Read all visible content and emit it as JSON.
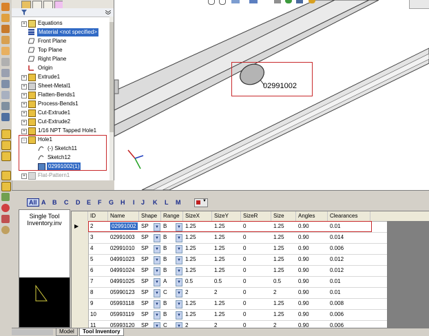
{
  "feature_tree": {
    "items": [
      {
        "label": "Equations",
        "expander": "+"
      },
      {
        "label": "Material <not specified>",
        "selected": true
      },
      {
        "label": "Front Plane"
      },
      {
        "label": "Top Plane"
      },
      {
        "label": "Right Plane"
      },
      {
        "label": "Origin"
      },
      {
        "label": "Extrude1",
        "expander": "+"
      },
      {
        "label": "Sheet-Metal1",
        "expander": "+"
      },
      {
        "label": "Flatten-Bends1",
        "expander": "+"
      },
      {
        "label": "Process-Bends1",
        "expander": "+"
      },
      {
        "label": "Cut-Extrude1",
        "expander": "+"
      },
      {
        "label": "Cut-Extrude2",
        "expander": "+"
      },
      {
        "label": "1/16 NPT Tapped Hole1",
        "expander": "+"
      },
      {
        "label": "Hole1",
        "expander": "−"
      },
      {
        "label": "(-) Sketch11"
      },
      {
        "label": "Sketch12"
      },
      {
        "label": "02991002(1)",
        "selected": true
      },
      {
        "label": "Flat-Pattern1",
        "expander": "+"
      }
    ]
  },
  "viewport": {
    "callout_label": "02991002"
  },
  "letters": [
    "All",
    "A",
    "B",
    "C",
    "D",
    "E",
    "F",
    "G",
    "H",
    "I",
    "J",
    "K",
    "L",
    "M"
  ],
  "inventory_pane": {
    "title": "Single Tool Inventory.inv"
  },
  "grid": {
    "columns": [
      "ID",
      "Name",
      "Shape",
      "Range",
      "SizeX",
      "SizeY",
      "SizeR",
      "Size",
      "Angles",
      "Clearances"
    ],
    "rows": [
      {
        "id": "2",
        "name": "02991002",
        "shape": "SP",
        "range": "B",
        "sizex": "1.25",
        "sizey": "1.25",
        "sizer": "0",
        "size": "1.25",
        "angles": "0.90",
        "clear": "0.01",
        "current": true
      },
      {
        "id": "3",
        "name": "02991003",
        "shape": "SP",
        "range": "B",
        "sizex": "1.25",
        "sizey": "1.25",
        "sizer": "0",
        "size": "1.25",
        "angles": "0.90",
        "clear": "0.014"
      },
      {
        "id": "4",
        "name": "02991010",
        "shape": "SP",
        "range": "B",
        "sizex": "1.25",
        "sizey": "1.25",
        "sizer": "0",
        "size": "1.25",
        "angles": "0.90",
        "clear": "0.006"
      },
      {
        "id": "5",
        "name": "04991023",
        "shape": "SP",
        "range": "B",
        "sizex": "1.25",
        "sizey": "1.25",
        "sizer": "0",
        "size": "1.25",
        "angles": "0.90",
        "clear": "0.012"
      },
      {
        "id": "6",
        "name": "04991024",
        "shape": "SP",
        "range": "B",
        "sizex": "1.25",
        "sizey": "1.25",
        "sizer": "0",
        "size": "1.25",
        "angles": "0.90",
        "clear": "0.012"
      },
      {
        "id": "7",
        "name": "04991025",
        "shape": "SP",
        "range": "A",
        "sizex": "0.5",
        "sizey": "0.5",
        "sizer": "0",
        "size": "0.5",
        "angles": "0.90",
        "clear": "0.01"
      },
      {
        "id": "8",
        "name": "05990123",
        "shape": "SP",
        "range": "C",
        "sizex": "2",
        "sizey": "2",
        "sizer": "0",
        "size": "2",
        "angles": "0.90",
        "clear": "0.01"
      },
      {
        "id": "9",
        "name": "05993118",
        "shape": "SP",
        "range": "B",
        "sizex": "1.25",
        "sizey": "1.25",
        "sizer": "0",
        "size": "1.25",
        "angles": "0.90",
        "clear": "0.008"
      },
      {
        "id": "10",
        "name": "05993119",
        "shape": "SP",
        "range": "B",
        "sizex": "1.25",
        "sizey": "1.25",
        "sizer": "0",
        "size": "1.25",
        "angles": "0.90",
        "clear": "0.006"
      },
      {
        "id": "11",
        "name": "05993120",
        "shape": "SP",
        "range": "C",
        "sizex": "2",
        "sizey": "2",
        "sizer": "0",
        "size": "2",
        "angles": "0.90",
        "clear": "0.006"
      }
    ]
  },
  "bottom_tabs": [
    {
      "label": "Model"
    },
    {
      "label": "Tool Inventory",
      "active": true
    }
  ],
  "colors": {
    "highlight_red": "#c8282a",
    "selection_blue": "#316ac5",
    "letter_blue": "#1a2c8c"
  }
}
